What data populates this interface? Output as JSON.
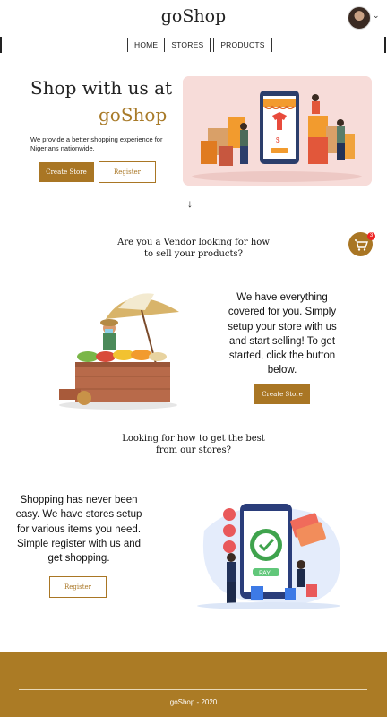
{
  "header": {
    "brand": "goShop",
    "nav": [
      "HOME",
      "STORES",
      "PRODUCTS"
    ]
  },
  "hero": {
    "title": "Shop with us at",
    "accent": "goShop",
    "description": "We provide a better shopping experience for Nigerians nationwide.",
    "create_store": "Create Store",
    "register": "Register"
  },
  "vendor": {
    "question": "Are you a Vendor looking for how to sell your products?",
    "text": "We have everything covered for you. Simply setup your store with us and start selling! To get started, click the button below.",
    "create_store": "Create Store"
  },
  "shopper": {
    "question": "Looking for how to get the best from our stores?",
    "text": "Shopping has never been easy. We have stores setup for various items you need. Simple register with us and get shopping.",
    "register": "Register"
  },
  "cart": {
    "count": "3"
  },
  "footer": {
    "text": "goShop - 2020"
  },
  "colors": {
    "accent": "#a97624",
    "footer": "#ab7b25",
    "badge": "#e22222"
  },
  "icons": {
    "cart": "cart-icon",
    "arrow": "arrow-down-icon",
    "caret": "chevron-down-icon"
  }
}
